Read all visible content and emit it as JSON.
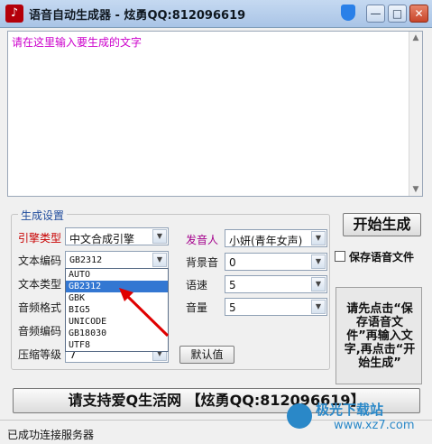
{
  "window": {
    "title": "语音自动生成器 - 炫勇QQ:812096619",
    "title_controls": {
      "minimize": "—",
      "maximize": "□",
      "close": "✕"
    }
  },
  "text_input": {
    "placeholder": "请在这里输入要生成的文字"
  },
  "settings": {
    "group_title": "生成设置",
    "engine": {
      "label": "引擎类型",
      "value": "中文合成引擎"
    },
    "encoding": {
      "label": "文本编码",
      "value": "GB2312"
    },
    "text_type": {
      "label": "文本类型"
    },
    "audio_format": {
      "label": "音频格式"
    },
    "audio_encoding": {
      "label": "音频编码"
    },
    "compression": {
      "label": "压缩等级",
      "value": "7"
    },
    "speaker": {
      "label": "发音人",
      "value": "小妍(青年女声)"
    },
    "bg_sound": {
      "label": "背景音",
      "value": "0"
    },
    "speed": {
      "label": "语速",
      "value": "5"
    },
    "volume": {
      "label": "音量",
      "value": "5"
    },
    "default_button": "默认值"
  },
  "encoding_dropdown": {
    "options": [
      "AUTO",
      "GB2312",
      "GBK",
      "BIG5",
      "UNICODE",
      "GB18030",
      "UTF8"
    ],
    "selected_index": 1
  },
  "actions": {
    "start_button": "开始生成",
    "save_audio_checkbox": {
      "label": "保存语音文件",
      "checked": false
    },
    "info_text": "请先点击“保存语音文件”再输入文字,再点击“开始生成”",
    "support_button": "请支持爱Q生活网 【炫勇QQ:812096619】"
  },
  "status": {
    "text": "已成功连接服务器"
  },
  "watermark": {
    "line1": "极光下载站",
    "line2": "www.xz7.com"
  },
  "colors": {
    "placeholder": "#cc00cc",
    "engine_label": "#c80000",
    "speaker_label": "#a4008c",
    "selection": "#3377d2",
    "arrow": "#e00000"
  }
}
